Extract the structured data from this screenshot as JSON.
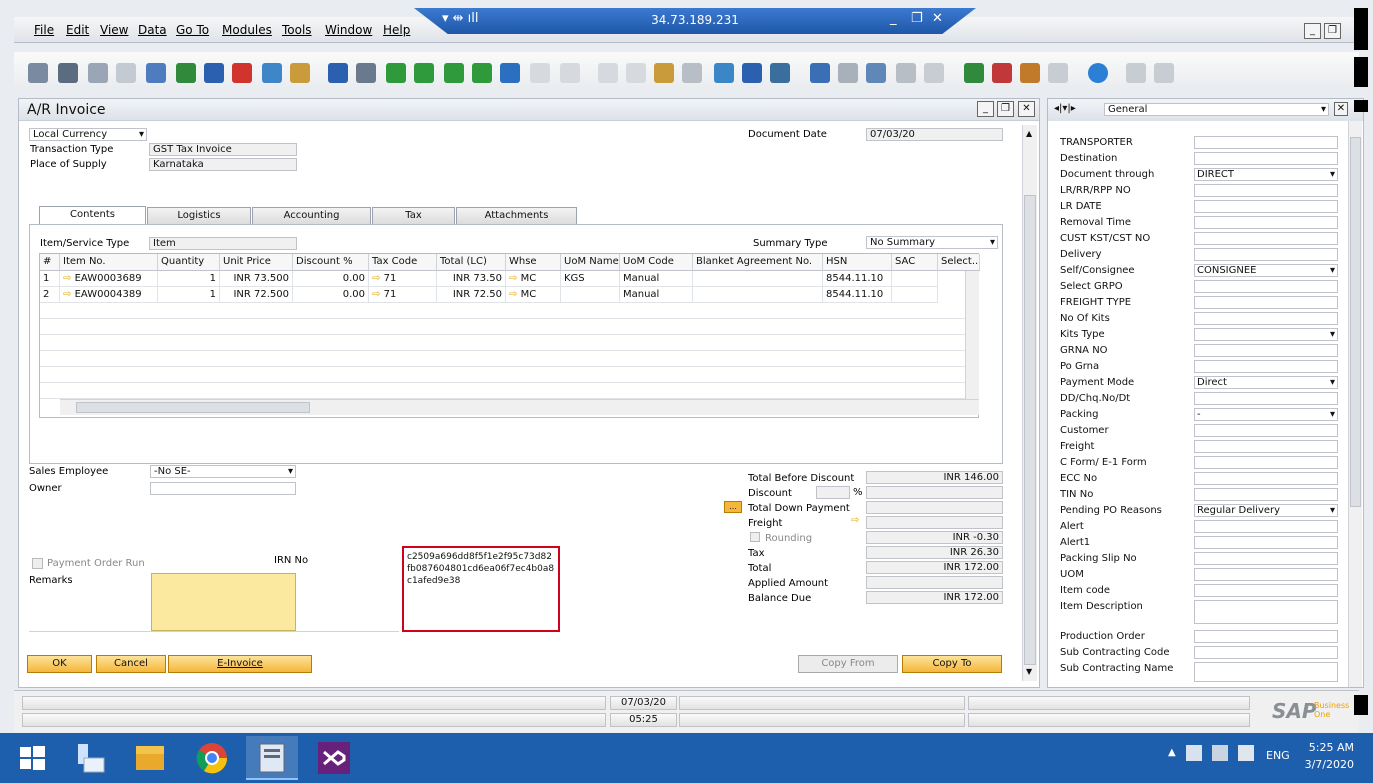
{
  "menu": [
    "File",
    "Edit",
    "View",
    "Data",
    "Go To",
    "Modules",
    "Tools",
    "Window",
    "Help"
  ],
  "rdp": {
    "host": "34.73.189.231"
  },
  "form": {
    "title": "A/R Invoice",
    "currency": "Local Currency",
    "transaction_type_label": "Transaction Type",
    "transaction_type": "GST Tax Invoice",
    "place_of_supply_label": "Place of Supply",
    "place_of_supply": "Karnataka",
    "document_date_label": "Document Date",
    "document_date": "07/03/20",
    "tabs": [
      "Contents",
      "Logistics",
      "Accounting",
      "Tax",
      "Attachments"
    ],
    "item_service_type_label": "Item/Service Type",
    "item_service_type": "Item",
    "summary_type_label": "Summary Type",
    "summary_type": "No Summary",
    "columns": [
      "#",
      "Item No.",
      "Quantity",
      "Unit Price",
      "Discount %",
      "Tax Code",
      "Total (LC)",
      "Whse",
      "UoM Name",
      "UoM Code",
      "Blanket Agreement No.",
      "HSN",
      "SAC",
      "Select..."
    ],
    "rows": [
      {
        "n": "1",
        "item": "EAW0003689",
        "qty": "1",
        "price": "INR 73.500",
        "disc": "0.00",
        "tax": "71",
        "total": "INR 73.50",
        "whse": "MC",
        "uom": "KGS",
        "uomcode": "Manual",
        "blanket": "",
        "hsn": "8544.11.10"
      },
      {
        "n": "2",
        "item": "EAW0004389",
        "qty": "1",
        "price": "INR 72.500",
        "disc": "0.00",
        "tax": "71",
        "total": "INR 72.50",
        "whse": "MC",
        "uom": "",
        "uomcode": "Manual",
        "blanket": "",
        "hsn": "8544.11.10"
      }
    ],
    "sales_employee_label": "Sales Employee",
    "sales_employee": "-No SE-",
    "owner_label": "Owner",
    "payment_order_run_label": "Payment Order Run",
    "irn_label": "IRN No",
    "irn_value": "c2509a696dd8f5f1e2f95c73d82fb087604801cd6ea06f7ec4b0a8c1afed9e38",
    "remarks_label": "Remarks",
    "totals": {
      "total_before_discount_label": "Total Before Discount",
      "total_before_discount": "INR 146.00",
      "discount_label": "Discount",
      "pct": "%",
      "total_down_payment_label": "Total Down Payment",
      "freight_label": "Freight",
      "rounding_label": "Rounding",
      "rounding": "INR -0.30",
      "tax_label": "Tax",
      "tax": "INR 26.30",
      "total_label": "Total",
      "total": "INR 172.00",
      "applied_amount_label": "Applied Amount",
      "balance_due_label": "Balance Due",
      "balance_due": "INR 172.00"
    },
    "buttons": {
      "ok": "OK",
      "cancel": "Cancel",
      "einvoice": "E-Invoice",
      "copy_from": "Copy From",
      "copy_to": "Copy To"
    }
  },
  "side": {
    "header": "General",
    "fields": [
      {
        "label": "TRANSPORTER",
        "value": ""
      },
      {
        "label": "Destination",
        "value": ""
      },
      {
        "label": "Document through",
        "value": "DIRECT",
        "dd": true
      },
      {
        "label": "LR/RR/RPP NO",
        "value": ""
      },
      {
        "label": "LR DATE",
        "value": ""
      },
      {
        "label": "Removal Time",
        "value": ""
      },
      {
        "label": "CUST KST/CST NO",
        "value": ""
      },
      {
        "label": "Delivery",
        "value": ""
      },
      {
        "label": "Self/Consignee",
        "value": "CONSIGNEE",
        "dd": true
      },
      {
        "label": "Select GRPO",
        "value": ""
      },
      {
        "label": "FREIGHT TYPE",
        "value": ""
      },
      {
        "label": "No Of Kits",
        "value": ""
      },
      {
        "label": "Kits Type",
        "value": "",
        "dd": true
      },
      {
        "label": "GRNA NO",
        "value": ""
      },
      {
        "label": "Po Grna",
        "value": ""
      },
      {
        "label": "Payment Mode",
        "value": "Direct",
        "dd": true
      },
      {
        "label": "DD/Chq.No/Dt",
        "value": ""
      },
      {
        "label": "Packing",
        "value": "-",
        "dd": true
      },
      {
        "label": "Customer",
        "value": ""
      },
      {
        "label": "Freight",
        "value": ""
      },
      {
        "label": "C Form/ E-1 Form",
        "value": ""
      },
      {
        "label": "ECC No",
        "value": ""
      },
      {
        "label": "TIN No",
        "value": ""
      },
      {
        "label": "Pending PO Reasons",
        "value": "Regular Delivery",
        "dd": true
      },
      {
        "label": "Alert",
        "value": ""
      },
      {
        "label": "Alert1",
        "value": ""
      },
      {
        "label": "Packing Slip No",
        "value": ""
      },
      {
        "label": "UOM",
        "value": ""
      },
      {
        "label": "Item code",
        "value": ""
      },
      {
        "label": "Item Description",
        "value": ""
      },
      {
        "label": "Production Order",
        "value": ""
      },
      {
        "label": "Sub Contracting Code",
        "value": ""
      },
      {
        "label": "Sub Contracting Name",
        "value": ""
      }
    ]
  },
  "status": {
    "date": "07/03/20",
    "time": "05:25",
    "brand": "SAP",
    "brand2": "Business One"
  },
  "taskbar": {
    "lang": "ENG",
    "time": "5:25 AM",
    "date": "3/7/2020"
  },
  "colors": {
    "accent": "#f4b63b",
    "highlight_border": "#d0021b",
    "remarks_bg": "#fbe9a0"
  }
}
